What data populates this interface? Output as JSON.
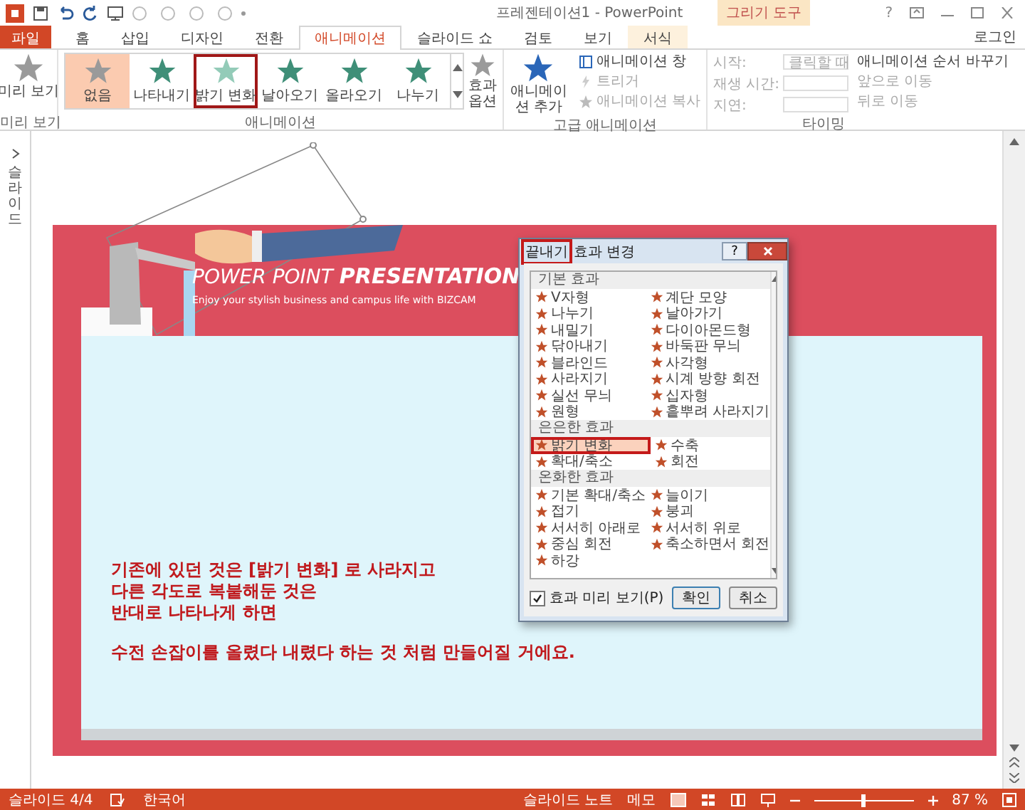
{
  "title_bar": {
    "title": "프레젠테이션1 - PowerPoint",
    "context_label": "그리기 도구",
    "help": "?"
  },
  "tabs": [
    {
      "label": "파일",
      "kind": "file",
      "selected": false
    },
    {
      "label": "홈",
      "kind": "tab",
      "selected": false
    },
    {
      "label": "삽입",
      "kind": "tab",
      "selected": false
    },
    {
      "label": "디자인",
      "kind": "tab",
      "selected": false
    },
    {
      "label": "전환",
      "kind": "tab",
      "selected": false
    },
    {
      "label": "애니메이션",
      "kind": "tab",
      "selected": true
    },
    {
      "label": "슬라이드 쇼",
      "kind": "tab",
      "selected": false
    },
    {
      "label": "검토",
      "kind": "tab",
      "selected": false
    },
    {
      "label": "보기",
      "kind": "tab",
      "selected": false
    },
    {
      "label": "서식",
      "kind": "context",
      "selected": false
    }
  ],
  "account": "로그인",
  "ribbon": {
    "preview": {
      "label": "미리 보기",
      "group": "미리 보기"
    },
    "gallery": {
      "group": "애니메이션",
      "effect_options": "효과 옵션",
      "items": [
        {
          "label": "없음",
          "kind": "none",
          "selected": true,
          "outlined": false
        },
        {
          "label": "나타내기",
          "kind": "burst",
          "selected": false,
          "outlined": false
        },
        {
          "label": "밝기 변화",
          "kind": "fade",
          "selected": false,
          "outlined": true
        },
        {
          "label": "날아오기",
          "kind": "fly",
          "selected": false,
          "outlined": false
        },
        {
          "label": "올라오기",
          "kind": "float",
          "selected": false,
          "outlined": false
        },
        {
          "label": "나누기",
          "kind": "split",
          "selected": false,
          "outlined": false
        }
      ]
    },
    "advanced": {
      "group": "고급 애니메이션",
      "add": "애니메이션 추가",
      "commands": [
        {
          "label": "애니메이션 창",
          "kind": "pane",
          "disabled": false
        },
        {
          "label": "트리거",
          "kind": "trigger",
          "disabled": true
        },
        {
          "label": "애니메이션 복사",
          "kind": "painter",
          "disabled": true
        }
      ]
    },
    "timing": {
      "group": "타이밍",
      "fields": [
        {
          "label": "시작:",
          "kind": "select",
          "value": "클릭할 때",
          "disabled": true
        },
        {
          "label": "재생 시간:",
          "kind": "spin",
          "disabled": true
        },
        {
          "label": "지연:",
          "kind": "spin",
          "disabled": true
        }
      ],
      "reorder": "애니메이션 순서 바꾸기",
      "moves": [
        {
          "label": "앞으로 이동",
          "disabled": true
        },
        {
          "label": "뒤로 이동",
          "disabled": true
        }
      ]
    }
  },
  "side_pane": {
    "label": "슬라이드"
  },
  "slide": {
    "title_light": "POWER POINT",
    "title_bold": "PRESENTATION",
    "subtitle": "Enjoy your stylish business and campus life with BIZCAM",
    "paragraphs": [
      [
        "기존에 있던 것은 [밝기 변화] 로 사라지고",
        "다른 각도로 복붙해둔 것은",
        "반대로 나타나게 하면"
      ],
      [
        "수전 손잡이를 올렸다 내렸다 하는 것 처럼 만들어질 거에요."
      ]
    ]
  },
  "dialog": {
    "title_parts": [
      {
        "text": "끝내기",
        "outlined": true
      },
      {
        "text": "효과 변경",
        "outlined": false
      }
    ],
    "help": "?",
    "sections": [
      {
        "heading": "기본 효과",
        "items": [
          {
            "label": "V자형",
            "selected": false,
            "outlined": false
          },
          {
            "label": "계단 모양",
            "selected": false,
            "outlined": false
          },
          {
            "label": "나누기",
            "selected": false,
            "outlined": false
          },
          {
            "label": "날아가기",
            "selected": false,
            "outlined": false
          },
          {
            "label": "내밀기",
            "selected": false,
            "outlined": false
          },
          {
            "label": "다이아몬드형",
            "selected": false,
            "outlined": false
          },
          {
            "label": "닦아내기",
            "selected": false,
            "outlined": false
          },
          {
            "label": "바둑판 무늬",
            "selected": false,
            "outlined": false
          },
          {
            "label": "블라인드",
            "selected": false,
            "outlined": false
          },
          {
            "label": "사각형",
            "selected": false,
            "outlined": false
          },
          {
            "label": "사라지기",
            "selected": false,
            "outlined": false
          },
          {
            "label": "시계 방향 회전",
            "selected": false,
            "outlined": false
          },
          {
            "label": "실선 무늬",
            "selected": false,
            "outlined": false
          },
          {
            "label": "십자형",
            "selected": false,
            "outlined": false
          },
          {
            "label": "원형",
            "selected": false,
            "outlined": false
          },
          {
            "label": "흩뿌려 사라지기",
            "selected": false,
            "outlined": false
          }
        ]
      },
      {
        "heading": "은은한 효과",
        "items": [
          {
            "label": "밝기 변화",
            "selected": true,
            "outlined": true
          },
          {
            "label": "수축",
            "selected": false,
            "outlined": false
          },
          {
            "label": "확대/축소",
            "selected": false,
            "outlined": false
          },
          {
            "label": "회전",
            "selected": false,
            "outlined": false
          }
        ]
      },
      {
        "heading": "온화한 효과",
        "items": [
          {
            "label": "기본 확대/축소",
            "selected": false,
            "outlined": false
          },
          {
            "label": "늘이기",
            "selected": false,
            "outlined": false
          },
          {
            "label": "접기",
            "selected": false,
            "outlined": false
          },
          {
            "label": "붕괴",
            "selected": false,
            "outlined": false
          },
          {
            "label": "서서히 아래로",
            "selected": false,
            "outlined": false
          },
          {
            "label": "서서히 위로",
            "selected": false,
            "outlined": false
          },
          {
            "label": "중심 회전",
            "selected": false,
            "outlined": false
          },
          {
            "label": "축소하면서 회전",
            "selected": false,
            "outlined": false
          },
          {
            "label": "하강",
            "selected": false,
            "outlined": false
          }
        ]
      }
    ],
    "preview": {
      "label": "효과 미리 보기(P)",
      "checked": true
    },
    "buttons": [
      "확인",
      "취소"
    ]
  },
  "status_bar": {
    "slide": "슬라이드 4/4",
    "language": "한국어",
    "notes": "슬라이드 노트",
    "comments": "메모",
    "zoom_slider": {
      "level": 0.5
    },
    "zoom": "87 %"
  }
}
